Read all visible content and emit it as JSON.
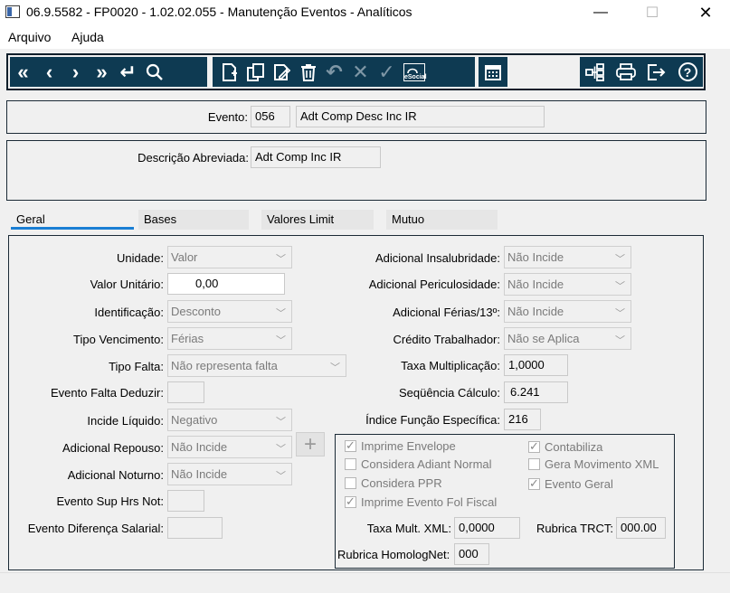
{
  "window": {
    "title": "06.9.5582 - FP0020 - 1.02.02.055 - Manutenção Eventos - Analíticos",
    "minimize": "—",
    "maximize": "☐",
    "close": "✕"
  },
  "menu": {
    "items": [
      "Arquivo",
      "Ajuda"
    ]
  },
  "toolbar": {
    "nav_icons": [
      "first-icon",
      "previous-icon",
      "next-icon",
      "last-icon",
      "return-icon",
      "search-icon"
    ],
    "edit_icons": [
      "new-record-icon",
      "copy-icon",
      "edit-icon",
      "delete-icon",
      "undo-icon",
      "cancel-icon",
      "confirm-icon",
      "esocial-icon"
    ],
    "esocial_label": "eSocial",
    "calendar_icon": "calendar-icon",
    "right_icons": [
      "structure-icon",
      "print-icon",
      "exit-icon",
      "help-icon"
    ],
    "help_glyph": "?"
  },
  "evento": {
    "label": "Evento:",
    "code": "056",
    "name": "Adt Comp Desc Inc IR"
  },
  "descricao": {
    "label": "Descrição Abreviada:",
    "value": "Adt Comp Inc IR"
  },
  "tabs": [
    "Geral",
    "Bases",
    "Valores Limit",
    "Mutuo"
  ],
  "geral": {
    "left": {
      "unidade": {
        "label": "Unidade:",
        "value": "Valor"
      },
      "valor_unitario": {
        "label": "Valor Unitário:",
        "value": "0,00"
      },
      "identificacao": {
        "label": "Identificação:",
        "value": "Desconto"
      },
      "tipo_vencimento": {
        "label": "Tipo Vencimento:",
        "value": "Férias"
      },
      "tipo_falta": {
        "label": "Tipo Falta:",
        "value": "Não representa falta"
      },
      "evento_falta_deduzir": {
        "label": "Evento Falta Deduzir:",
        "value": ""
      },
      "incide_liquido": {
        "label": "Incide Líquido:",
        "value": "Negativo"
      },
      "adicional_repouso": {
        "label": "Adicional Repouso:",
        "value": "Não Incide"
      },
      "adicional_noturno": {
        "label": "Adicional Noturno:",
        "value": "Não Incide"
      },
      "evento_sup_hrs_not": {
        "label": "Evento Sup Hrs Not:",
        "value": ""
      },
      "evento_diferenca_salarial": {
        "label": "Evento Diferença Salarial:",
        "value": ""
      },
      "add_button": "+"
    },
    "right": {
      "adicional_insalubridade": {
        "label": "Adicional Insalubridade:",
        "value": "Não Incide"
      },
      "adicional_periculosidade": {
        "label": "Adicional Periculosidade:",
        "value": "Não Incide"
      },
      "adicional_ferias": {
        "label": "Adicional Férias/13º:",
        "value": "Não Incide"
      },
      "credito_trabalhador": {
        "label": "Crédito Trabalhador:",
        "value": "Não se Aplica"
      },
      "taxa_multiplicacao": {
        "label": "Taxa Multiplicação:",
        "value": "1,0000"
      },
      "sequencia_calculo": {
        "label": "Seqüência Cálculo:",
        "value": "6.241"
      },
      "indice_funcao": {
        "label": "Índice Função Específica:",
        "value": "216"
      }
    },
    "checks": [
      {
        "label": "Imprime Envelope",
        "checked": true
      },
      {
        "label": "Contabiliza",
        "checked": true
      },
      {
        "label": "Considera Adiant Normal",
        "checked": false
      },
      {
        "label": "Gera Movimento XML",
        "checked": false
      },
      {
        "label": "Considera PPR",
        "checked": false
      },
      {
        "label": "Evento Geral",
        "checked": true
      },
      {
        "label": "Imprime Evento Fol Fiscal",
        "checked": true
      }
    ],
    "taxa_mult_xml": {
      "label": "Taxa Mult. XML:",
      "value": "0,0000"
    },
    "rubrica_trct": {
      "label": "Rubrica TRCT:",
      "value": "000.00"
    },
    "rubrica_homolognet": {
      "label": "Rubrica HomologNet:",
      "value": "000"
    }
  },
  "colors": {
    "toolbar_bg": "#0e3a52",
    "tab_accent": "#1a7fd4",
    "frame_border": "#1b2a36"
  }
}
